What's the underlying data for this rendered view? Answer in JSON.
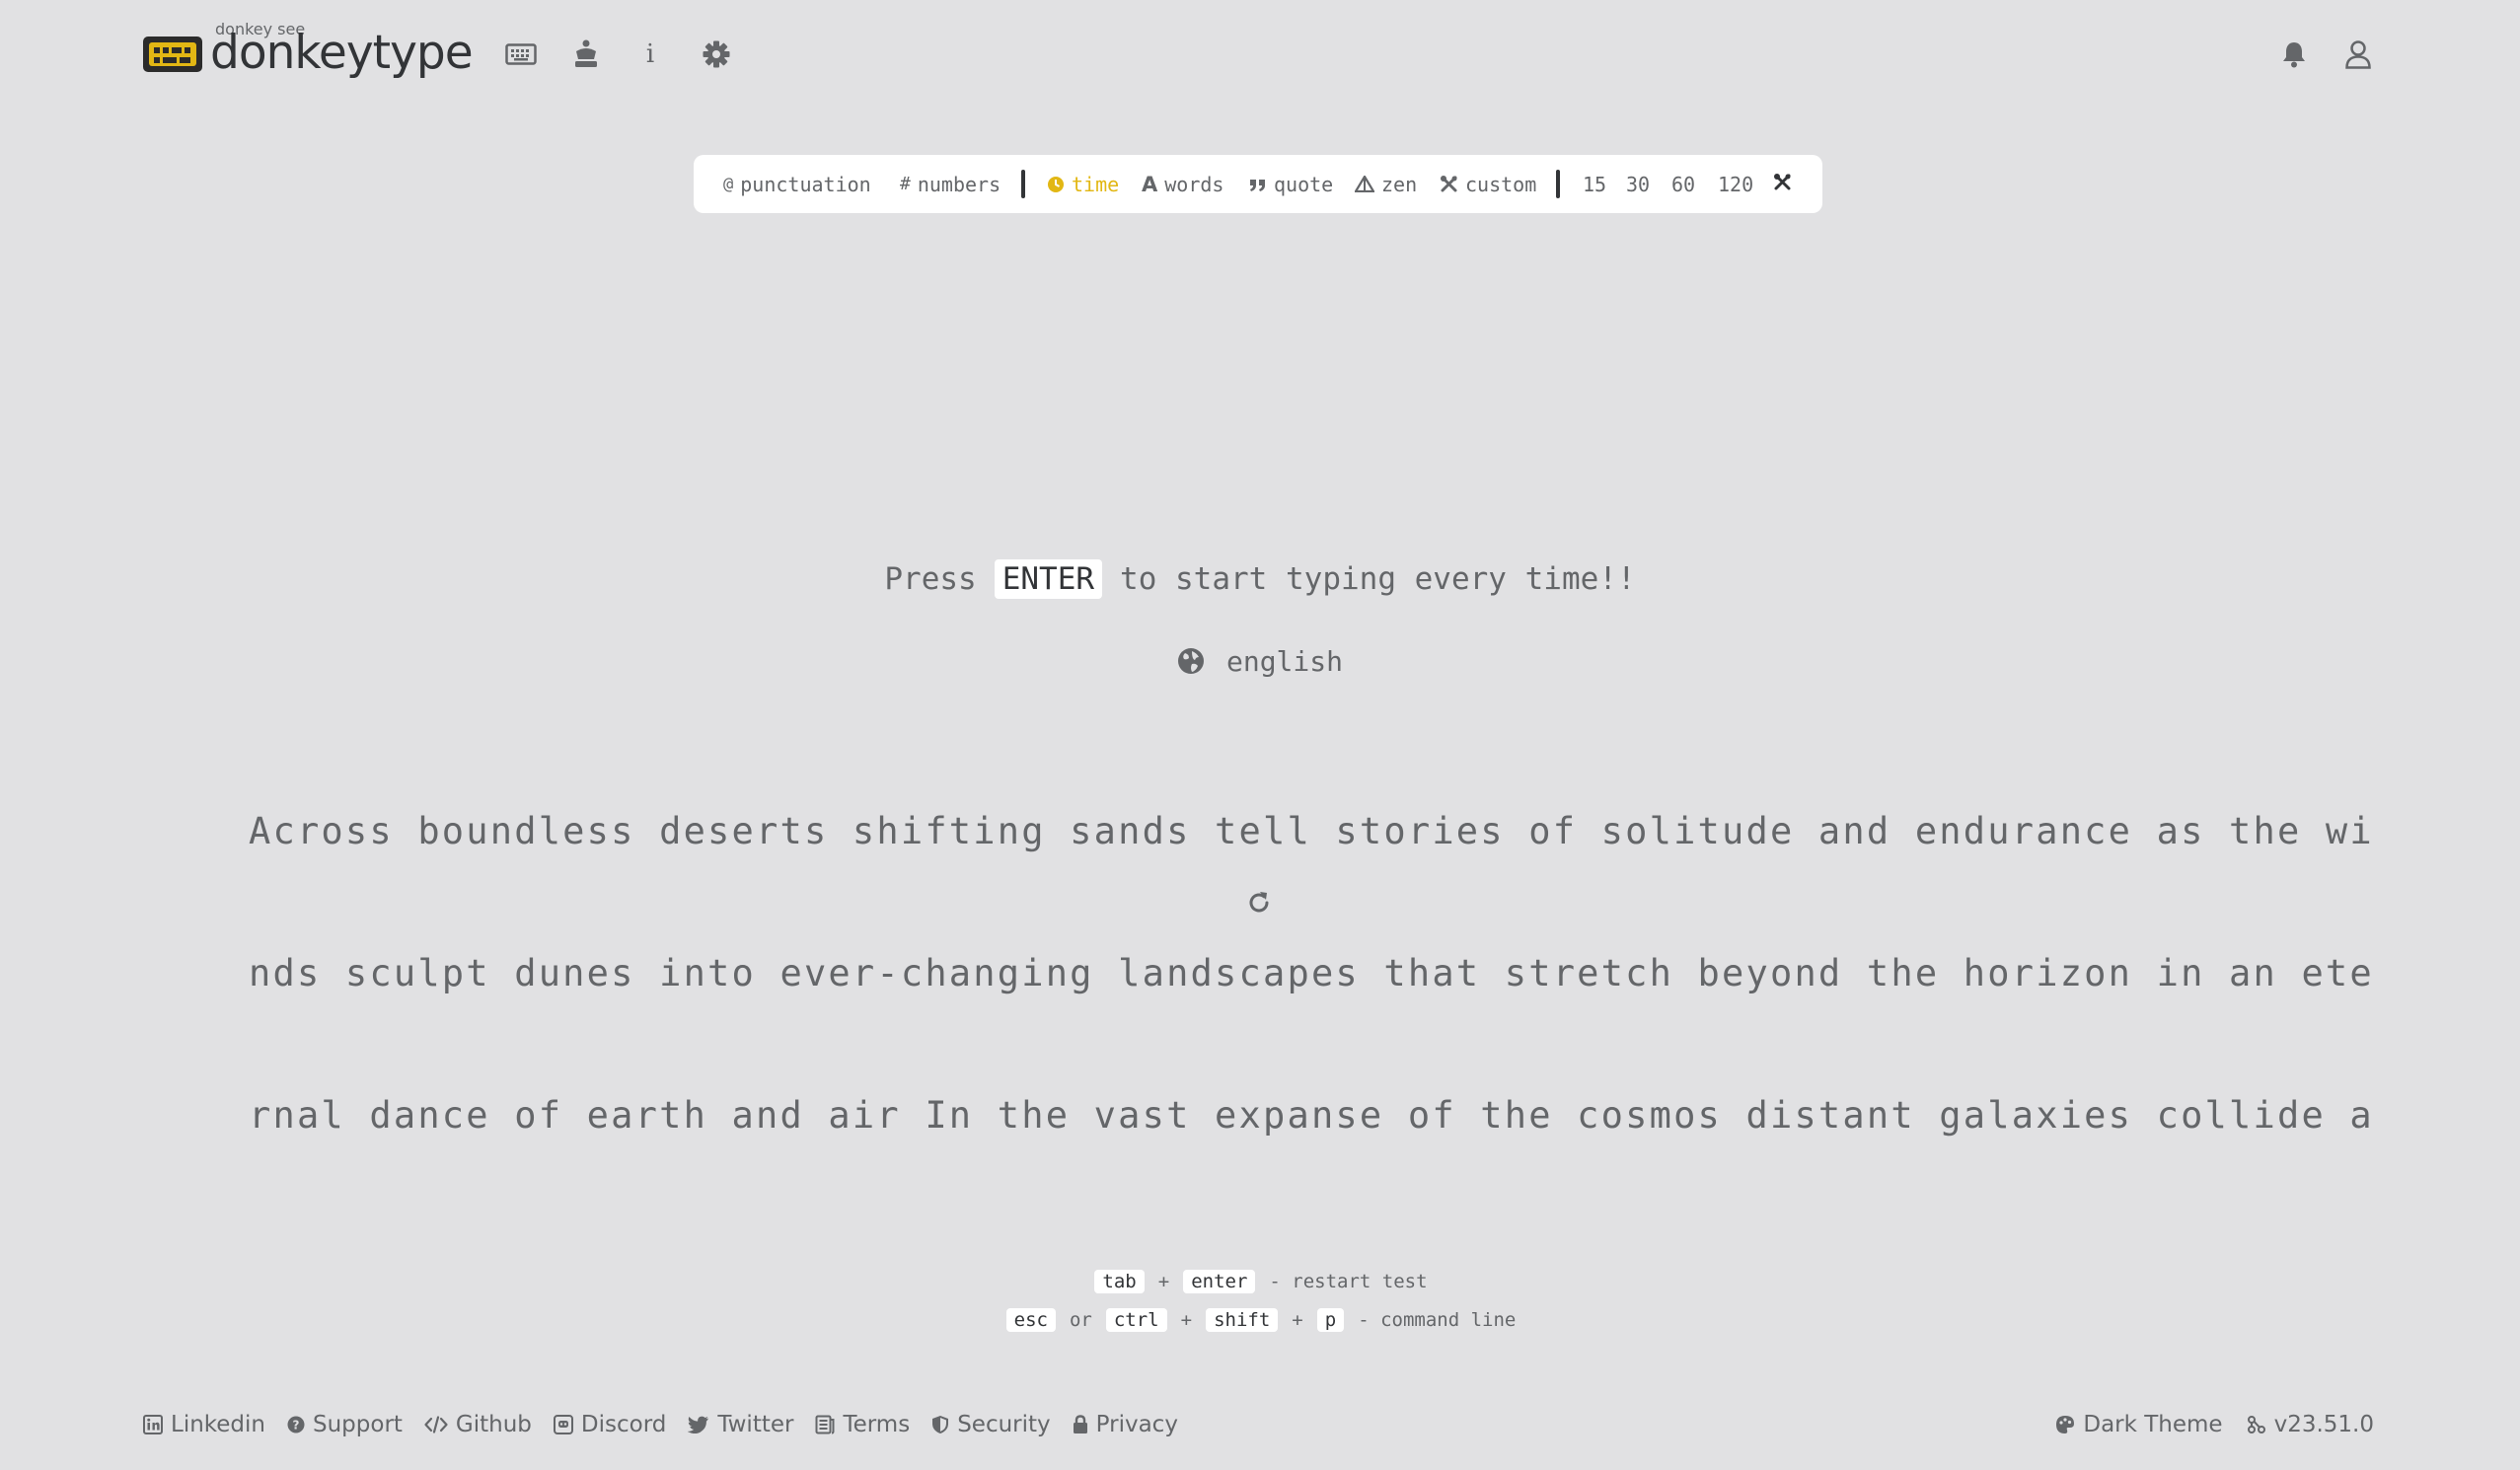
{
  "header": {
    "logo_top_text": "donkey see",
    "logo_text": "donkeytype",
    "nav_icons": [
      "keyboard-icon",
      "crown-icon",
      "info-icon",
      "gear-icon"
    ],
    "info_glyph": "i",
    "right_icons": [
      "bell-icon",
      "user-icon"
    ]
  },
  "config": {
    "punctuation": "punctuation",
    "numbers": "numbers",
    "time": "time",
    "words": "words",
    "quote": "quote",
    "zen": "zen",
    "custom": "custom",
    "durations": [
      "15",
      "30",
      "60",
      "120"
    ],
    "active_mode": "time",
    "punctuation_glyph": "@",
    "numbers_glyph": "#",
    "words_glyph": "A"
  },
  "test": {
    "press_prefix": "Press",
    "press_key": "ENTER",
    "press_suffix": "to start typing every time!!",
    "language": "english",
    "words_lines": [
      "Across boundless deserts shifting sands tell stories of solitude and endurance as the wi",
      "nds sculpt dunes into ever-changing landscapes that stretch beyond the horizon in an ete",
      "rnal dance of earth and air In the vast expanse of the cosmos distant galaxies collide a"
    ]
  },
  "hints": {
    "row1": {
      "key1": "tab",
      "plus": "+",
      "key2": "enter",
      "desc": "- restart test"
    },
    "row2": {
      "key1": "esc",
      "or": "or",
      "key2": "ctrl",
      "plus1": "+",
      "key3": "shift",
      "plus2": "+",
      "key4": "p",
      "desc": "- command line"
    }
  },
  "footer": {
    "links": [
      "Linkedin",
      "Support",
      "Github",
      "Discord",
      "Twitter",
      "Terms",
      "Security",
      "Privacy"
    ],
    "theme": "Dark Theme",
    "version": "v23.51.0"
  },
  "colors": {
    "background": "#e1e1e3",
    "accent": "#e2b714",
    "text": "#646669",
    "main": "#323437",
    "panel": "#ffffff"
  }
}
